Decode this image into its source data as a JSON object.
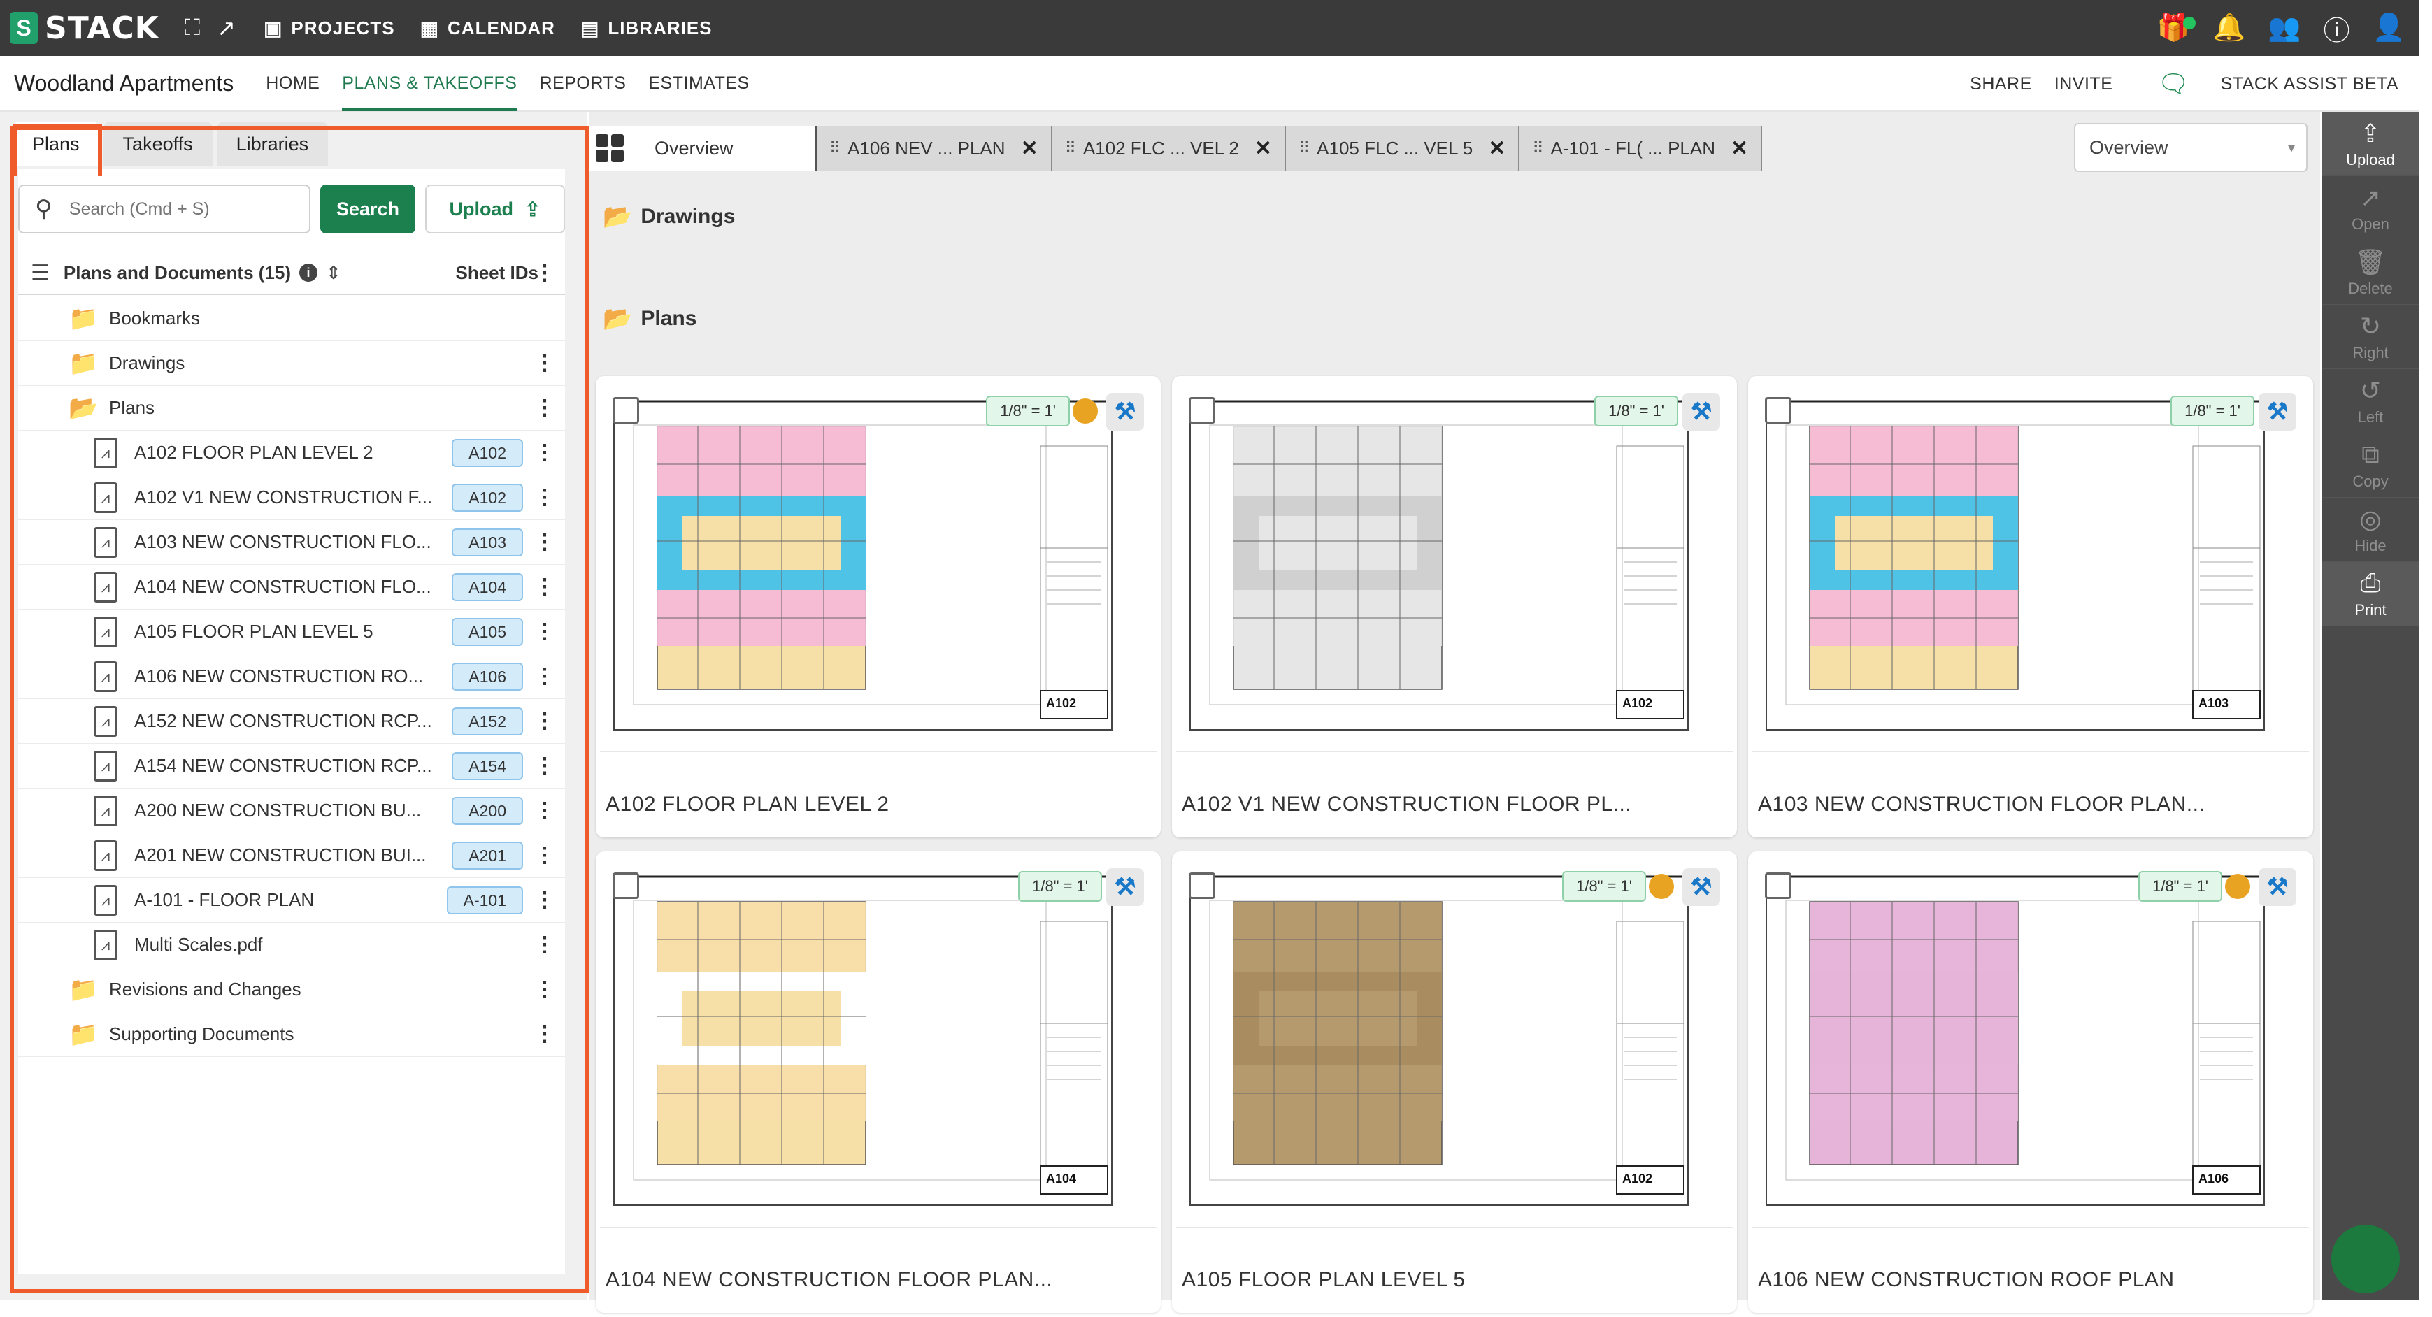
{
  "topbar": {
    "logo_text": "STACK",
    "nav": [
      {
        "label": "PROJECTS",
        "icon": "briefcase-icon"
      },
      {
        "label": "CALENDAR",
        "icon": "calendar-icon"
      },
      {
        "label": "LIBRARIES",
        "icon": "library-icon"
      }
    ],
    "right_icons": [
      "gift-icon",
      "bell-icon",
      "users-icon",
      "help-icon",
      "user-settings-icon"
    ]
  },
  "subbar": {
    "project_name": "Woodland Apartments",
    "nav": [
      "HOME",
      "PLANS & TAKEOFFS",
      "REPORTS",
      "ESTIMATES"
    ],
    "active_nav": "PLANS & TAKEOFFS",
    "share": "SHARE",
    "invite": "INVITE",
    "assist": "STACK ASSIST BETA"
  },
  "leftpanel": {
    "tabs": [
      "Plans",
      "Takeoffs",
      "Libraries"
    ],
    "active_tab": "Plans",
    "search_placeholder": "Search (Cmd + S)",
    "search_button": "Search",
    "upload_button": "Upload",
    "list_title": "Plans and Documents (15)",
    "sheet_ids_label": "Sheet IDs",
    "tree": [
      {
        "type": "folder",
        "label": "Bookmarks",
        "kebab": false
      },
      {
        "type": "folder",
        "label": "Drawings",
        "kebab": true
      },
      {
        "type": "folder-open",
        "label": "Plans",
        "kebab": true
      },
      {
        "type": "file",
        "label": "A102 FLOOR PLAN LEVEL 2",
        "sheet": "A102"
      },
      {
        "type": "file",
        "label": "A102 V1 NEW CONSTRUCTION F...",
        "sheet": "A102"
      },
      {
        "type": "file",
        "label": "A103 NEW CONSTRUCTION FLO...",
        "sheet": "A103"
      },
      {
        "type": "file",
        "label": "A104 NEW CONSTRUCTION FLO...",
        "sheet": "A104"
      },
      {
        "type": "file",
        "label": "A105 FLOOR PLAN LEVEL 5",
        "sheet": "A105"
      },
      {
        "type": "file",
        "label": "A106 NEW CONSTRUCTION RO...",
        "sheet": "A106"
      },
      {
        "type": "file",
        "label": "A152 NEW CONSTRUCTION RCP...",
        "sheet": "A152"
      },
      {
        "type": "file",
        "label": "A154 NEW CONSTRUCTION RCP...",
        "sheet": "A154"
      },
      {
        "type": "file",
        "label": "A200 NEW CONSTRUCTION BU...",
        "sheet": "A200"
      },
      {
        "type": "file",
        "label": "A201 NEW CONSTRUCTION BUI...",
        "sheet": "A201"
      },
      {
        "type": "file",
        "label": "A-101 - FLOOR PLAN",
        "sheet": "A-101"
      },
      {
        "type": "file",
        "label": "Multi Scales.pdf",
        "sheet": ""
      },
      {
        "type": "folder",
        "label": "Revisions and Changes",
        "kebab": true
      },
      {
        "type": "folder",
        "label": "Supporting Documents",
        "kebab": true
      }
    ]
  },
  "main": {
    "overview_tab": "Overview",
    "doc_tabs": [
      "A106 NEV ... PLAN",
      "A102 FLC ... VEL 2",
      "A105 FLC ... VEL 5",
      "A-101 - FL( ... PLAN"
    ],
    "view_select": "Overview",
    "section_drawings": "Drawings",
    "section_plans": "Plans",
    "cards": [
      {
        "title": "A102 FLOOR PLAN LEVEL 2",
        "scale": "1/8\" = 1'",
        "status": true,
        "sheet": "A102",
        "tint": "#f4b8d8",
        "band": "#4fc3e6",
        "tint2": "#f7dfa8"
      },
      {
        "title": "A102 V1 NEW CONSTRUCTION FLOOR PL...",
        "scale": "1/8\" = 1'",
        "status": false,
        "sheet": "A102",
        "tint": "#e6e6e6",
        "band": "#d0d0d0",
        "tint2": "#e6e6e6"
      },
      {
        "title": "A103 NEW CONSTRUCTION FLOOR PLAN...",
        "scale": "1/8\" = 1'",
        "status": false,
        "sheet": "A103",
        "tint": "#f4b8d8",
        "band": "#4fc3e6",
        "tint2": "#f7dfa8"
      },
      {
        "title": "A104 NEW CONSTRUCTION FLOOR PLAN...",
        "scale": "1/8\" = 1'",
        "status": false,
        "sheet": "A104",
        "tint": "#f7dfa8",
        "band": "#ffffff",
        "tint2": "#f7dfa8"
      },
      {
        "title": "A105 FLOOR PLAN LEVEL 5",
        "scale": "1/8\" = 1'",
        "status": true,
        "sheet": "A102",
        "tint": "#b59a6e",
        "band": "#a98d60",
        "tint2": "#b59a6e"
      },
      {
        "title": "A106 NEW CONSTRUCTION ROOF PLAN",
        "scale": "1/8\" = 1'",
        "status": true,
        "sheet": "A106",
        "tint": "#e7b4d9",
        "band": "#e7b4d9",
        "tint2": "#e7b4d9"
      }
    ]
  },
  "rightbar": [
    {
      "label": "Upload",
      "icon": "upload-icon",
      "enabled": true
    },
    {
      "label": "Open",
      "icon": "open-icon",
      "enabled": false
    },
    {
      "label": "Delete",
      "icon": "trash-icon",
      "enabled": false
    },
    {
      "label": "Right",
      "icon": "rotate-right-icon",
      "enabled": false
    },
    {
      "label": "Left",
      "icon": "rotate-left-icon",
      "enabled": false
    },
    {
      "label": "Copy",
      "icon": "copy-icon",
      "enabled": false
    },
    {
      "label": "Hide",
      "icon": "hide-icon",
      "enabled": false
    },
    {
      "label": "Print",
      "icon": "print-icon",
      "enabled": true
    }
  ],
  "colors": {
    "brand_green": "#1c7f4e",
    "highlight_orange": "#ef5b2a",
    "status_orange": "#e9a322",
    "sheet_blue": "#d4ebfa"
  }
}
